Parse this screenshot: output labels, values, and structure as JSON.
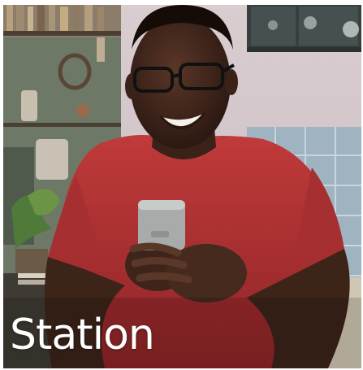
{
  "tile": {
    "caption": "Station",
    "image_subject": "man-smiling-at-phone-photo"
  }
}
